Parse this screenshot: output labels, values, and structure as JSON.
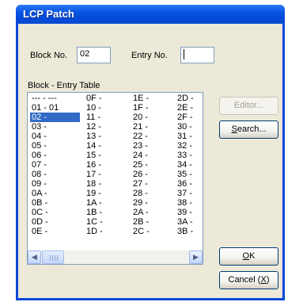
{
  "window": {
    "title": "LCP Patch"
  },
  "block_no": {
    "label": "Block No.",
    "value": "02"
  },
  "entry_no": {
    "label": "Entry No.",
    "value": ""
  },
  "table": {
    "label": "Block - Entry Table",
    "columns": [
      [
        "--- - ---",
        "01 - 01",
        "02 -",
        "03 -",
        "04 -",
        "05 -",
        "06 -",
        "07 -",
        "08 -",
        "09 -",
        "0A -",
        "0B -",
        "0C -",
        "0D -",
        "0E -"
      ],
      [
        "0F -",
        "10 -",
        "11 -",
        "12 -",
        "13 -",
        "14 -",
        "15 -",
        "16 -",
        "17 -",
        "18 -",
        "19 -",
        "1A -",
        "1B -",
        "1C -",
        "1D -"
      ],
      [
        "1E -",
        "1F -",
        "20 -",
        "21 -",
        "22 -",
        "23 -",
        "24 -",
        "25 -",
        "26 -",
        "27 -",
        "28 -",
        "29 -",
        "2A -",
        "2B -",
        "2C -"
      ],
      [
        "2D -",
        "2E -",
        "2F -",
        "30 -",
        "31 -",
        "32 -",
        "33 -",
        "34 -",
        "35 -",
        "36 -",
        "37 -",
        "38 -",
        "39 -",
        "3A -",
        "3B -"
      ]
    ],
    "selected": "02 -"
  },
  "buttons": {
    "editor": {
      "label": "Editor...",
      "enabled": false
    },
    "search": {
      "label": "Search...",
      "accel": "S",
      "rest": "earch..."
    },
    "ok": {
      "label": "OK",
      "accel": "O",
      "rest": "K"
    },
    "cancel": {
      "label": "Cancel (X)",
      "pre": "Cancel (",
      "accel": "X",
      "post": ")"
    }
  },
  "scrollbar": {
    "left_icon": "arrow-left-icon",
    "right_icon": "arrow-right-icon"
  },
  "colors": {
    "titlebar": "#0a58e6",
    "selection": "#316ac5",
    "dialog": "#ece9d8"
  }
}
